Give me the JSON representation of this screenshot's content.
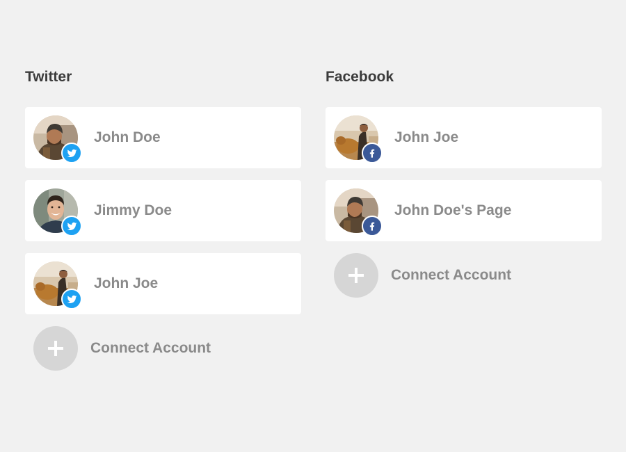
{
  "twitter": {
    "title": "Twitter",
    "accounts": [
      {
        "name": "John Doe",
        "avatar_icon": "hiker-with-beanie-avatar",
        "badge_icon": "twitter-bird-icon"
      },
      {
        "name": "Jimmy Doe",
        "avatar_icon": "smiling-man-avatar",
        "badge_icon": "twitter-bird-icon"
      },
      {
        "name": "John Joe",
        "avatar_icon": "person-with-dog-avatar",
        "badge_icon": "twitter-bird-icon"
      }
    ],
    "connect_label": "Connect Account",
    "badge_color": "#1da1f2"
  },
  "facebook": {
    "title": "Facebook",
    "accounts": [
      {
        "name": "John Joe",
        "avatar_icon": "person-with-dog-avatar",
        "badge_icon": "facebook-f-icon"
      },
      {
        "name": "John Doe's Page",
        "avatar_icon": "hiker-with-beanie-avatar",
        "badge_icon": "facebook-f-icon"
      }
    ],
    "connect_label": "Connect Account",
    "badge_color": "#3b5998"
  },
  "colors": {
    "background": "#f1f1f1",
    "card": "#ffffff",
    "title_text": "#3b3b3b",
    "name_text": "#8a8a8a",
    "connect_circle": "#d6d6d6"
  }
}
